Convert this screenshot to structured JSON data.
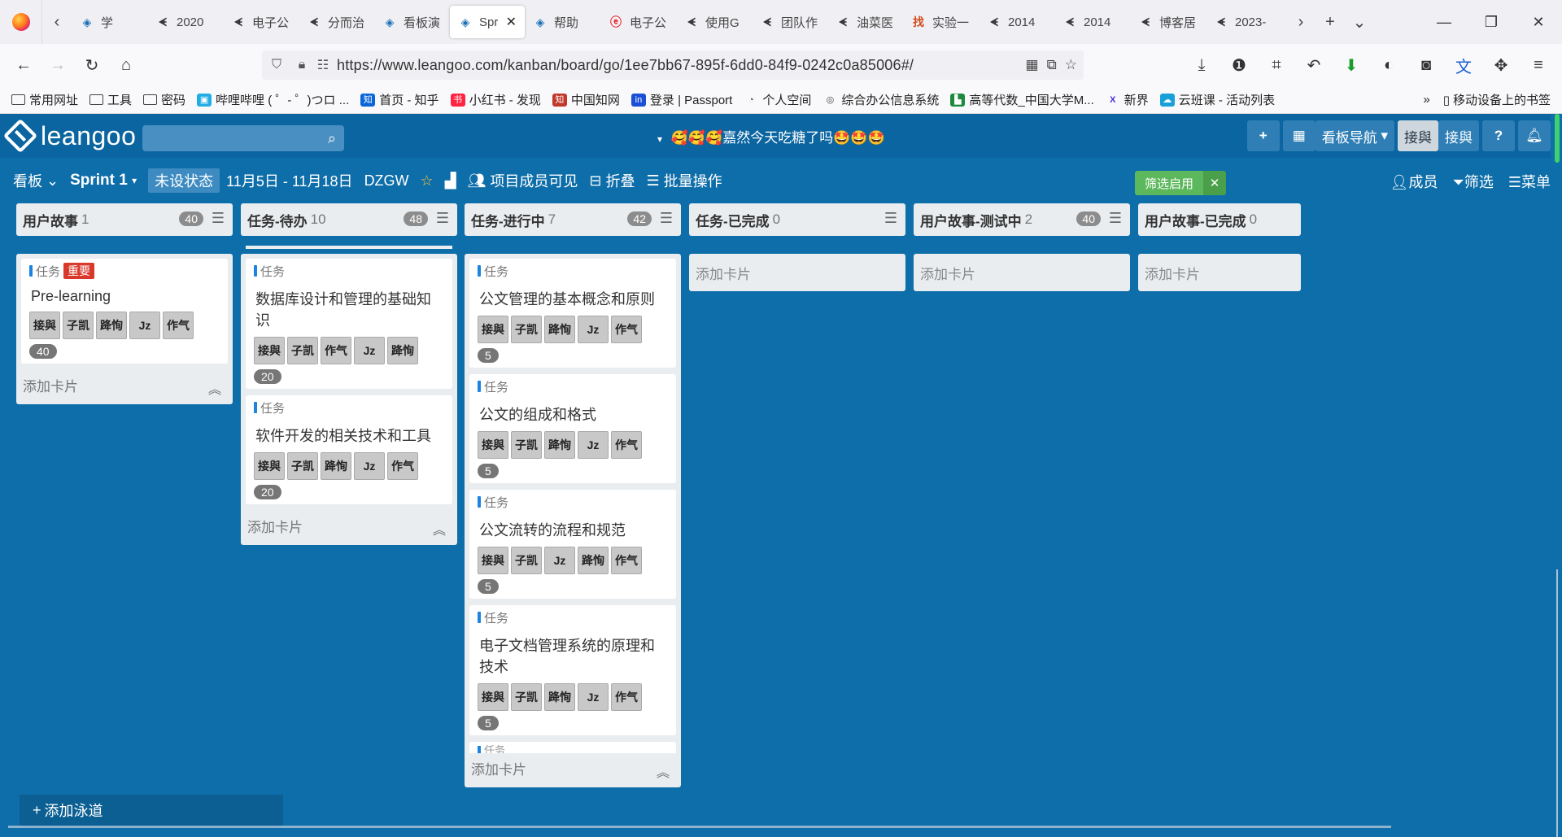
{
  "browser": {
    "tabs": [
      {
        "label": "学",
        "icon": "leangoo-icon"
      },
      {
        "label": "2020",
        "icon": "book-icon"
      },
      {
        "label": "电子公",
        "icon": "book-icon"
      },
      {
        "label": "分而治",
        "icon": "book-icon"
      },
      {
        "label": "看板演",
        "icon": "leangoo-icon"
      },
      {
        "label": "Spr",
        "icon": "leangoo-icon",
        "active": true
      },
      {
        "label": "帮助",
        "icon": "leangoo-icon"
      },
      {
        "label": "电子公",
        "icon": "ie-icon"
      },
      {
        "label": "使用G",
        "icon": "book-icon"
      },
      {
        "label": "团队作",
        "icon": "book-icon"
      },
      {
        "label": "油菜医",
        "icon": "book-icon"
      },
      {
        "label": "实验一",
        "icon": "find-icon"
      },
      {
        "label": "2014",
        "icon": "book-icon"
      },
      {
        "label": "2014",
        "icon": "book-icon"
      },
      {
        "label": "博客居",
        "icon": "book-icon"
      },
      {
        "label": "2023-",
        "icon": "book-icon"
      }
    ],
    "url": "https://www.leangoo.com/kanban/board/go/1ee7bb67-895f-6dd0-84f9-0242c0a85006#/",
    "bookmarks": [
      {
        "label": "常用网址",
        "icon": "folder-icon"
      },
      {
        "label": "工具",
        "icon": "folder-icon"
      },
      {
        "label": "密码",
        "icon": "folder-icon"
      },
      {
        "label": "哔哩哔哩 ( ゜- ゜)つロ ...",
        "icon": "bilibili-icon"
      },
      {
        "label": "首页 - 知乎",
        "icon": "zhihu-icon"
      },
      {
        "label": "小红书 - 发现",
        "icon": "xiaohongshu-icon"
      },
      {
        "label": "中国知网",
        "icon": "cnki-icon"
      },
      {
        "label": "登录 | Passport",
        "icon": "passport-icon"
      },
      {
        "label": "个人空间",
        "icon": "space-icon"
      },
      {
        "label": "综合办公信息系统",
        "icon": "globe-icon"
      },
      {
        "label": "高等代数_中国大学M...",
        "icon": "mooc-icon"
      },
      {
        "label": "新界",
        "icon": "x-icon"
      },
      {
        "label": "云班课 - 活动列表",
        "icon": "cloud-icon"
      }
    ],
    "bookmarks_right": "移动设备上的书签"
  },
  "app": {
    "logo_text": "leangoo",
    "board_title": "🥰🥰🥰嘉然今天吃糖了吗🤩🤩🤩",
    "nav_label": "看板导航",
    "user_name_1": "接與",
    "user_name_2": "接與",
    "help_label": "?"
  },
  "toolbar": {
    "view_label": "看板",
    "sprint_label": "Sprint 1",
    "state_label": "未设状态",
    "date_range": "11月5日 - 11月18日",
    "code": "DZGW",
    "visibility_label": "项目成员可见",
    "fold_label": "折叠",
    "batch_label": "批量操作",
    "filter_on_label": "筛选启用",
    "members_label": "成员",
    "filter_label": "筛选",
    "menu_label": "菜单"
  },
  "columns": [
    {
      "name": "用户故事",
      "count": "1",
      "points": "40",
      "cards": [
        {
          "type": "任务",
          "tag": "重要",
          "title": "Pre-learning",
          "members": [
            "接與",
            "子凯",
            "跭恂",
            "Jz",
            "作气"
          ],
          "points": "40"
        }
      ],
      "add_label": "添加卡片"
    },
    {
      "name": "任务-待办",
      "count": "10",
      "points": "48",
      "cards": [
        {
          "type": "任务",
          "title": "数据库设计和管理的基础知识",
          "members": [
            "接與",
            "子凯",
            "作气",
            "Jz",
            "跭恂"
          ],
          "points": "20"
        },
        {
          "type": "任务",
          "title": "软件开发的相关技术和工具",
          "members": [
            "接與",
            "子凯",
            "跭恂",
            "Jz",
            "作气"
          ],
          "points": "20"
        }
      ],
      "add_label": "添加卡片"
    },
    {
      "name": "任务-进行中",
      "count": "7",
      "points": "42",
      "cards": [
        {
          "type": "任务",
          "title": "公文管理的基本概念和原则",
          "members": [
            "接與",
            "子凯",
            "跭恂",
            "Jz",
            "作气"
          ],
          "points": "5"
        },
        {
          "type": "任务",
          "title": "公文的组成和格式",
          "members": [
            "接與",
            "子凯",
            "跭恂",
            "Jz",
            "作气"
          ],
          "points": "5"
        },
        {
          "type": "任务",
          "title": "公文流转的流程和规范",
          "members": [
            "接與",
            "子凯",
            "Jz",
            "跭恂",
            "作气"
          ],
          "points": "5"
        },
        {
          "type": "任务",
          "title": "电子文档管理系统的原理和技术",
          "members": [
            "接與",
            "子凯",
            "跭恂",
            "Jz",
            "作气"
          ],
          "points": "5"
        }
      ],
      "peek_label": "任务",
      "add_label": "添加卡片"
    },
    {
      "name": "任务-已完成",
      "count": "0",
      "add_label": "添加卡片"
    },
    {
      "name": "用户故事-测试中",
      "count": "2",
      "points": "40",
      "add_label": "添加卡片"
    },
    {
      "name": "用户故事-已完成",
      "count": "0",
      "add_label": "添加卡片"
    }
  ],
  "add_lane_label": "添加泳道",
  "colors": {
    "accent": "#0e6eaa",
    "header": "#0a65a0",
    "important": "#d9382b",
    "filter_on": "#5cb85c"
  }
}
